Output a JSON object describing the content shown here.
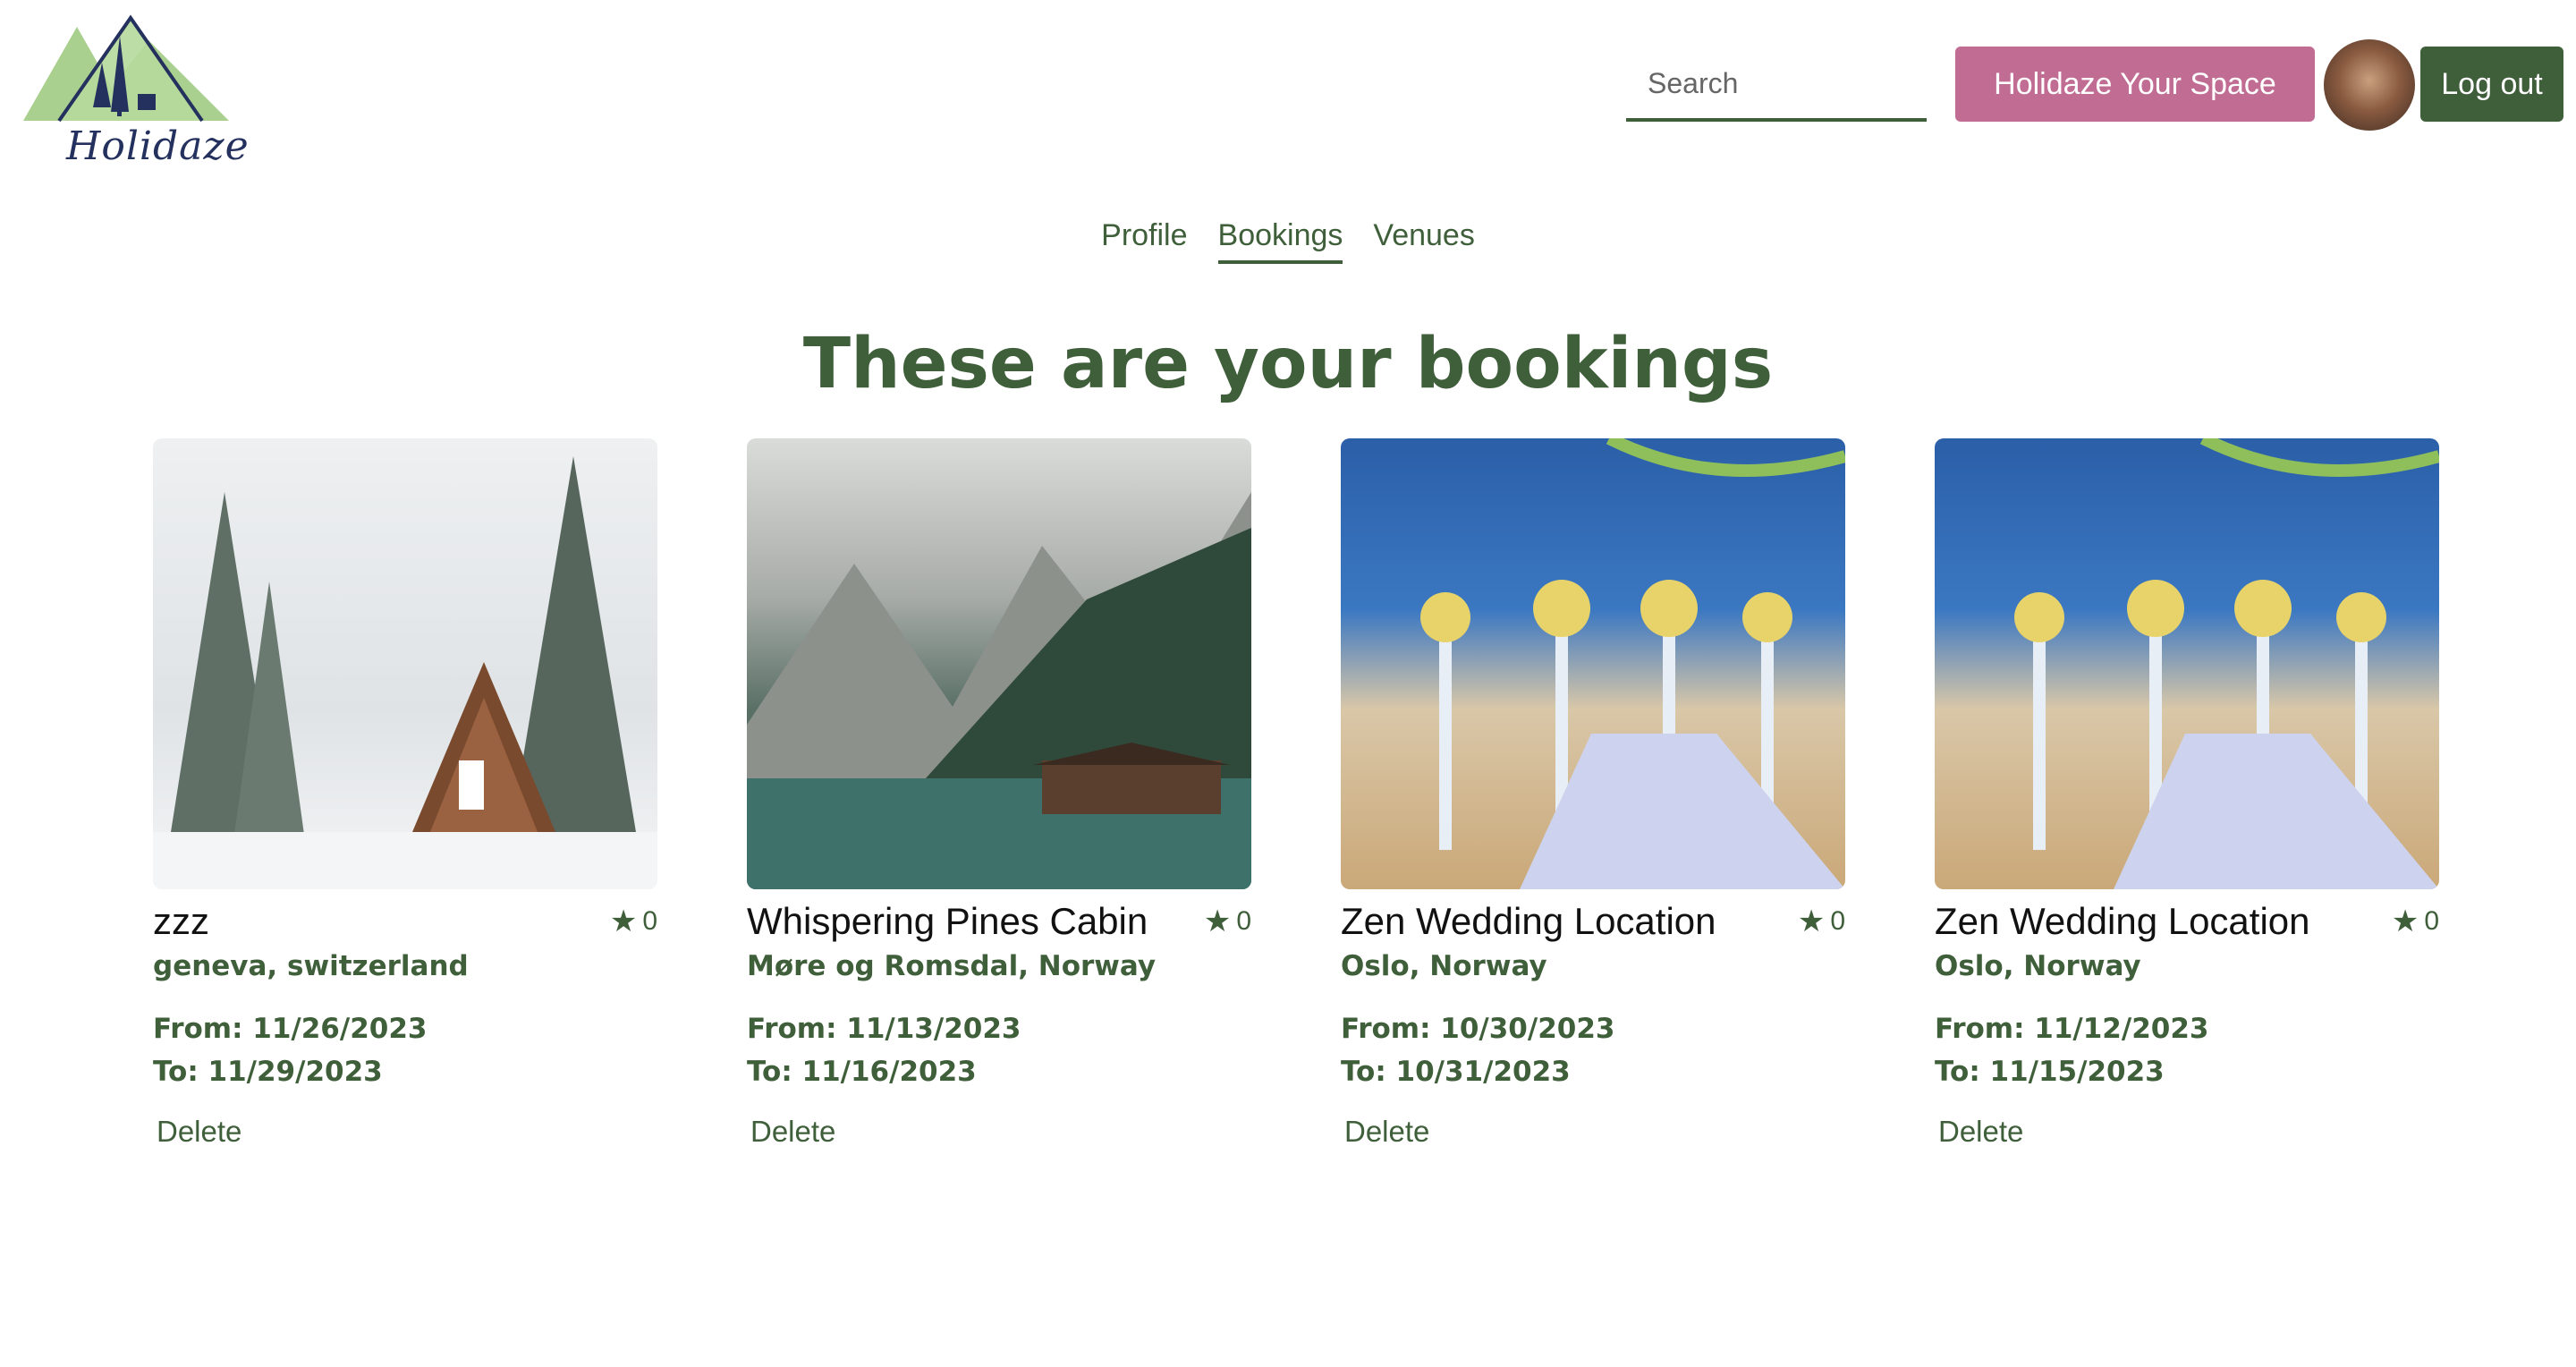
{
  "header": {
    "logo_text": "Holidaze",
    "search_placeholder": "Search",
    "space_button": "Holidaze Your Space",
    "logout_button": "Log out"
  },
  "tabs": [
    {
      "label": "Profile",
      "active": false
    },
    {
      "label": "Bookings",
      "active": true
    },
    {
      "label": "Venues",
      "active": false
    }
  ],
  "heading": "These are your bookings",
  "bookings": [
    {
      "name": "zzz",
      "rating": "0",
      "location": "geneva, switzerland",
      "from": "From: 11/26/2023",
      "to": "To: 11/29/2023",
      "delete": "Delete"
    },
    {
      "name": "Whispering Pines Cabin",
      "rating": "0",
      "location": "Møre og Romsdal, Norway",
      "from": "From: 11/13/2023",
      "to": "To: 11/16/2023",
      "delete": "Delete"
    },
    {
      "name": "Zen Wedding Location",
      "rating": "0",
      "location": "Oslo, Norway",
      "from": "From: 10/30/2023",
      "to": "To: 10/31/2023",
      "delete": "Delete"
    },
    {
      "name": "Zen Wedding Location",
      "rating": "0",
      "location": "Oslo, Norway",
      "from": "From: 11/12/2023",
      "to": "To: 11/15/2023",
      "delete": "Delete"
    }
  ],
  "colors": {
    "brand_green": "#3f5e3a",
    "accent_pink": "#c06c93"
  },
  "icons": {
    "rating": "star-icon"
  }
}
